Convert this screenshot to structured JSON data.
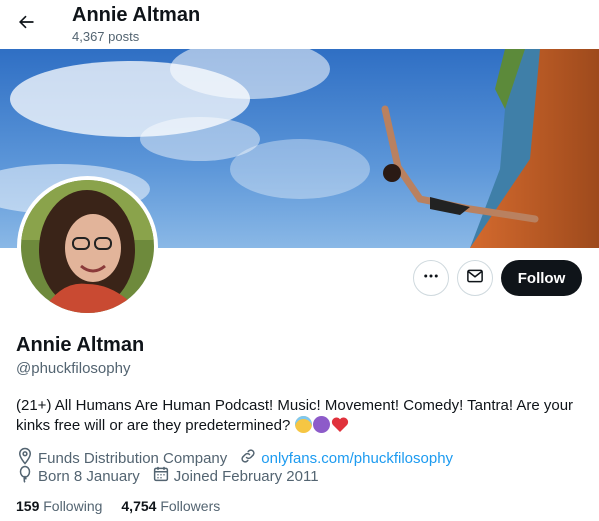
{
  "header": {
    "name": "Annie Altman",
    "posts": "4,367 posts"
  },
  "icons": {
    "back": "arrow-left-icon",
    "more": "more-horizontal-icon",
    "message": "envelope-icon",
    "location": "location-pin-icon",
    "website": "link-icon",
    "birthday": "balloon-icon",
    "joined": "calendar-icon"
  },
  "actions": {
    "follow_label": "Follow"
  },
  "profile": {
    "name": "Annie Altman",
    "handle": "@phuckfilosophy",
    "bio": "(21+) All Humans Are Human Podcast! Music! Movement! Comedy! Tantra! Are your kinks free will or are they predetermined?",
    "bio_emojis": [
      "smiling-face-with-halo",
      "smiling-face-with-horns",
      "red-heart"
    ],
    "location": "Funds Distribution Company",
    "website": "onlyfans.com/phuckfilosophy",
    "born": "Born 8 January",
    "joined": "Joined February 2011"
  },
  "stats": {
    "following_count": "159",
    "following_label": "Following",
    "followers_count": "4,754",
    "followers_label": "Followers"
  },
  "colors": {
    "text": "#0f1419",
    "secondary": "#536471",
    "link": "#1d9bf0",
    "follow_bg": "#0f1419"
  }
}
